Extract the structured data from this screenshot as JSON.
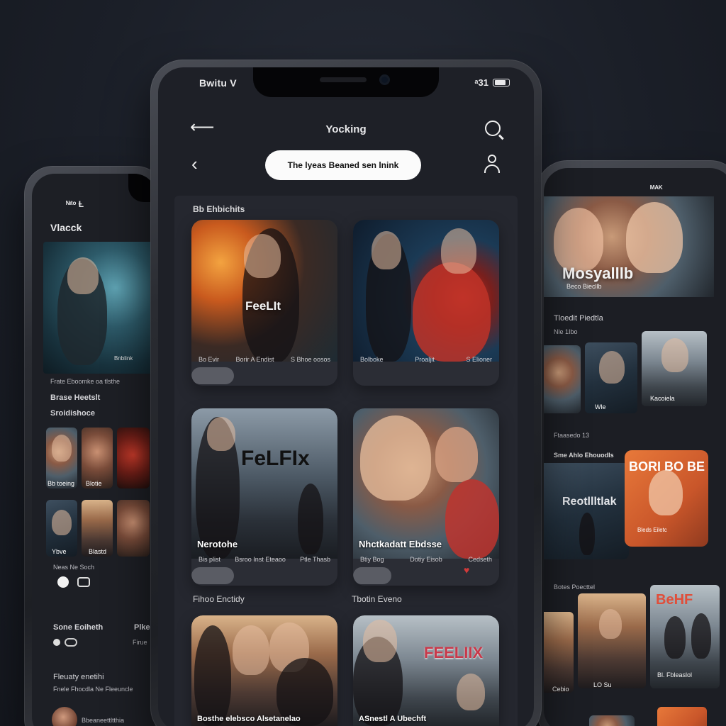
{
  "main_phone": {
    "status": {
      "left": "Bwitu V",
      "right": "ᵃ31"
    },
    "header": {
      "title": "Yocking"
    },
    "search": {
      "value": "The lyeas Beaned sen lnink"
    },
    "sections": [
      {
        "label": "Bb Ehbichits"
      },
      {
        "label": "Fihoo Enctidy"
      },
      {
        "label": "Tbotin Eveno"
      }
    ],
    "cards": [
      {
        "poster_text": "FeeLIt",
        "meta_left": "Bo Evir",
        "meta_mid": "Borir  A  Endist",
        "meta_right": "S Bhoe oosos",
        "progress": 0.25
      },
      {
        "poster_text": "",
        "meta_left": "Bolboke",
        "meta_mid": "Proaljit",
        "meta_right": "S Elioner",
        "progress": 0
      },
      {
        "poster_text": "FeLFIx",
        "title": "Nerotohe",
        "meta_left": "Bis plist",
        "meta_mid": "Bsroo  Inst Eteaoo",
        "meta_right": "Ptle Thasb",
        "progress": 0.25
      },
      {
        "poster_text": "",
        "title": "Nhctkadatt Ebdsse",
        "meta_left": "Btiy Bog",
        "meta_mid": "Dotiy Eisob",
        "meta_right": "Cedseth",
        "progress": 0.25
      },
      {
        "poster_text": "",
        "title": "Bosthe elebsco Alsetanelao",
        "meta_left": "",
        "meta_mid": "",
        "meta_right": "",
        "progress": 0
      },
      {
        "poster_text": "FEELIIX",
        "title": "ASnestl  A  Ubechft",
        "meta_left": "",
        "meta_mid": "",
        "meta_right": "",
        "progress": 0
      }
    ]
  },
  "left_phone": {
    "status": "ᴺᶦᵗᵒ Ƚ",
    "title": "Vlacck",
    "hero_caption": "Frate  Eboomke oa tlsthe",
    "hero_sub": "Bnblink",
    "label_1": "Brase Heetslt",
    "label_2": "Sroidishoce",
    "thumb_caption_1": "Bb toeing",
    "thumb_caption_2": "Blotie",
    "thumb_caption_3": "Ybve",
    "thumb_caption_4": "Blastd",
    "link_text": "Neas Ne Soch",
    "row_label": "Sone Eoiheth",
    "row_right": "Plke",
    "row_sub": "Firue",
    "label_3": "Fleuaty enetihi",
    "label_4": "Fnele Fhocdla Ne Fleeuncle",
    "avatar_name": "Bbeaneettltthia"
  },
  "right_phone": {
    "status": "ᴹᴬᴷ",
    "hero_text": "Mosyalllb",
    "hero_sub": "Beco  Biecllb",
    "label_1": "Tloedit Piedtla",
    "label_2": "Nle 1Ibo",
    "label_3": "Ftaasedo 13",
    "label_4": "Sme Ahlo Ehouodls",
    "poster_2": "BORI BO  BE",
    "poster_1_text": "Reotllltlak",
    "poster_1_sub": "Bleds Eiletc",
    "label_5": "Botes Poecttel",
    "poster_3": "BeHF",
    "caption_1": "Cebio",
    "caption_2": "LO Su",
    "caption_3": "Bl. Fbleaslol",
    "thumb_caption_1": "Wle",
    "thumb_caption_2": "Kacoiela"
  },
  "colors": {
    "background": "#1b1f28",
    "screen": "#1e2027",
    "panel": "#25272f",
    "accent_heart": "#d23a3a",
    "search_pill": "#fbfbfb"
  }
}
